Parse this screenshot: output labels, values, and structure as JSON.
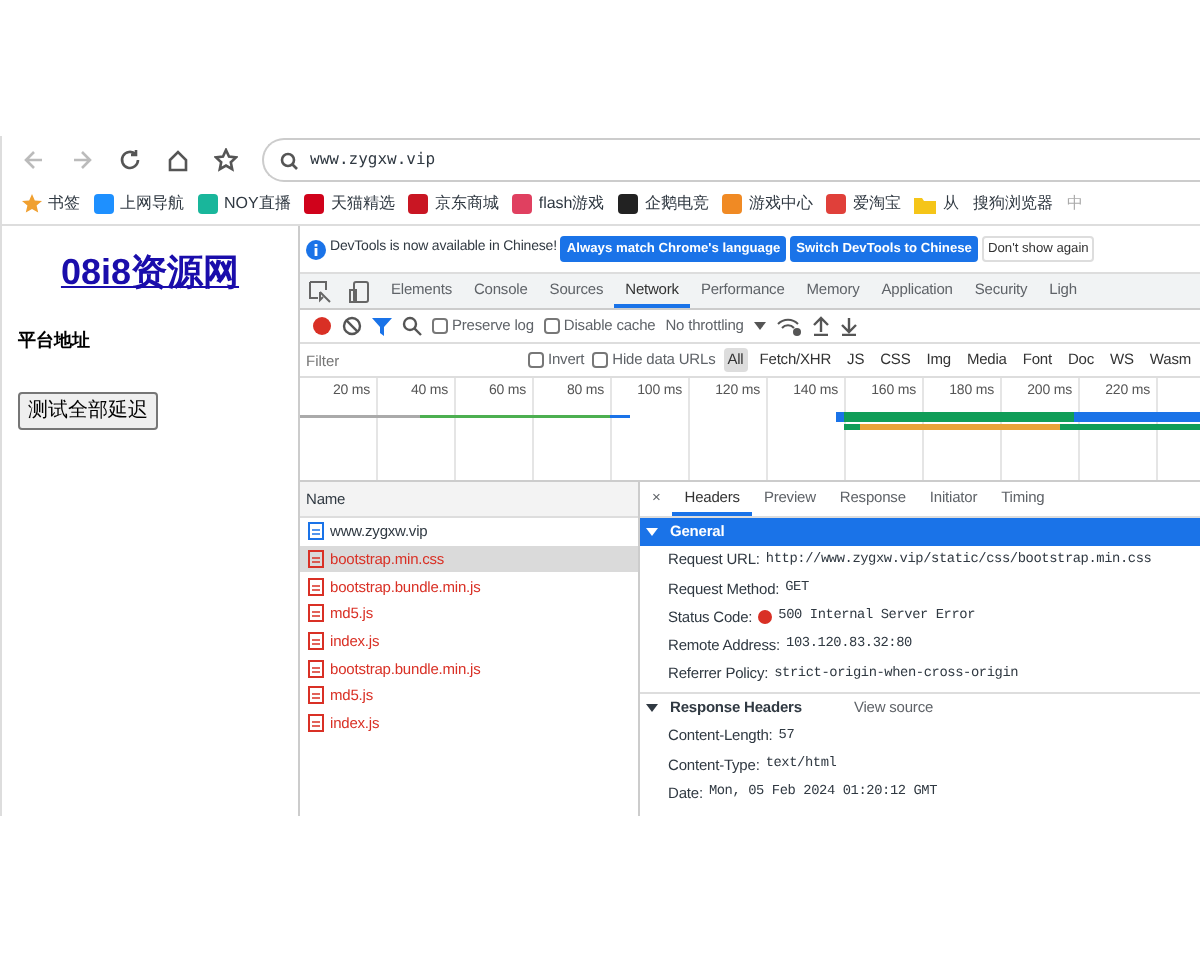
{
  "browser": {
    "address": "www.zygxw.vip",
    "bookmarks": [
      {
        "label": "书签",
        "faded": false
      },
      {
        "label": "上网导航",
        "faded": false
      },
      {
        "label": "NOY直播",
        "faded": false
      },
      {
        "label": "天猫精选",
        "faded": false
      },
      {
        "label": "京东商城",
        "faded": false
      },
      {
        "label": "flash游戏",
        "faded": false
      },
      {
        "label": "企鹅电竞",
        "faded": false
      },
      {
        "label": "游戏中心",
        "faded": false
      },
      {
        "label": "爱淘宝",
        "faded": false
      },
      {
        "label": "从",
        "faded": false
      },
      {
        "label": "搜狗浏览器",
        "faded": false
      },
      {
        "label": "中",
        "faded": true
      }
    ]
  },
  "page": {
    "title": "08i8资源网",
    "subtitle": "平台地址",
    "button": "测试全部延迟"
  },
  "devtools": {
    "infobar": {
      "message": "DevTools is now available in Chinese!",
      "buttons": [
        {
          "label": "Always match Chrome's language",
          "primary": true
        },
        {
          "label": "Switch DevTools to Chinese",
          "primary": true
        },
        {
          "label": "Don't show again",
          "primary": false
        }
      ]
    },
    "tabs": [
      {
        "label": "Elements",
        "selected": false
      },
      {
        "label": "Console",
        "selected": false
      },
      {
        "label": "Sources",
        "selected": false
      },
      {
        "label": "Network",
        "selected": true
      },
      {
        "label": "Performance",
        "selected": false
      },
      {
        "label": "Memory",
        "selected": false
      },
      {
        "label": "Application",
        "selected": false
      },
      {
        "label": "Security",
        "selected": false
      },
      {
        "label": "Ligh",
        "selected": false
      }
    ],
    "toolbar": {
      "preserve_log": {
        "label": "Preserve log",
        "checked": false
      },
      "disable_cache": {
        "label": "Disable cache",
        "checked": false
      },
      "throttling": "No throttling"
    },
    "filter": {
      "placeholder": "Filter",
      "invert": {
        "label": "Invert",
        "checked": false
      },
      "hide_data_urls": {
        "label": "Hide data URLs",
        "checked": false
      },
      "types": [
        {
          "label": "All",
          "selected": true
        },
        {
          "label": "Fetch/XHR",
          "selected": false
        },
        {
          "label": "JS",
          "selected": false
        },
        {
          "label": "CSS",
          "selected": false
        },
        {
          "label": "Img",
          "selected": false
        },
        {
          "label": "Media",
          "selected": false
        },
        {
          "label": "Font",
          "selected": false
        },
        {
          "label": "Doc",
          "selected": false
        },
        {
          "label": "WS",
          "selected": false
        },
        {
          "label": "Wasm",
          "selected": false
        }
      ]
    },
    "overview_ticks": [
      "20 ms",
      "40 ms",
      "60 ms",
      "80 ms",
      "100 ms",
      "120 ms",
      "140 ms",
      "160 ms",
      "180 ms",
      "200 ms",
      "220 ms"
    ],
    "requests": {
      "column": "Name",
      "rows": [
        {
          "name": "www.zygxw.vip",
          "failed": false,
          "selected": false
        },
        {
          "name": "bootstrap.min.css",
          "failed": true,
          "selected": true
        },
        {
          "name": "bootstrap.bundle.min.js",
          "failed": true,
          "selected": false
        },
        {
          "name": "md5.js",
          "failed": true,
          "selected": false
        },
        {
          "name": "index.js",
          "failed": true,
          "selected": false
        },
        {
          "name": "bootstrap.bundle.min.js",
          "failed": true,
          "selected": false
        },
        {
          "name": "md5.js",
          "failed": true,
          "selected": false
        },
        {
          "name": "index.js",
          "failed": true,
          "selected": false
        }
      ]
    },
    "detail": {
      "close": "×",
      "tabs": [
        {
          "label": "Headers",
          "selected": true
        },
        {
          "label": "Preview",
          "selected": false
        },
        {
          "label": "Response",
          "selected": false
        },
        {
          "label": "Initiator",
          "selected": false
        },
        {
          "label": "Timing",
          "selected": false
        }
      ],
      "sections": [
        {
          "title": "General",
          "highlighted": true,
          "expanded": true,
          "rows": [
            {
              "kind": "text",
              "key": "Request URL:",
              "value": "http://www.zygxw.vip/static/css/bootstrap.min.css"
            },
            {
              "kind": "text",
              "key": "Request Method:",
              "value": "GET"
            },
            {
              "kind": "status",
              "key": "Status Code:",
              "value": "500 Internal Server Error"
            },
            {
              "kind": "text",
              "key": "Remote Address:",
              "value": "103.120.83.32:80"
            },
            {
              "kind": "text",
              "key": "Referrer Policy:",
              "value": "strict-origin-when-cross-origin"
            }
          ]
        },
        {
          "title": "Response Headers",
          "link": "View source",
          "highlighted": false,
          "expanded": true,
          "rows": [
            {
              "kind": "text",
              "key": "Content-Length:",
              "value": "57"
            },
            {
              "kind": "text",
              "key": "Content-Type:",
              "value": "text/html"
            },
            {
              "kind": "text",
              "key": "Date:",
              "value": "Mon, 05 Feb 2024 01:20:12 GMT"
            }
          ]
        }
      ]
    }
  }
}
